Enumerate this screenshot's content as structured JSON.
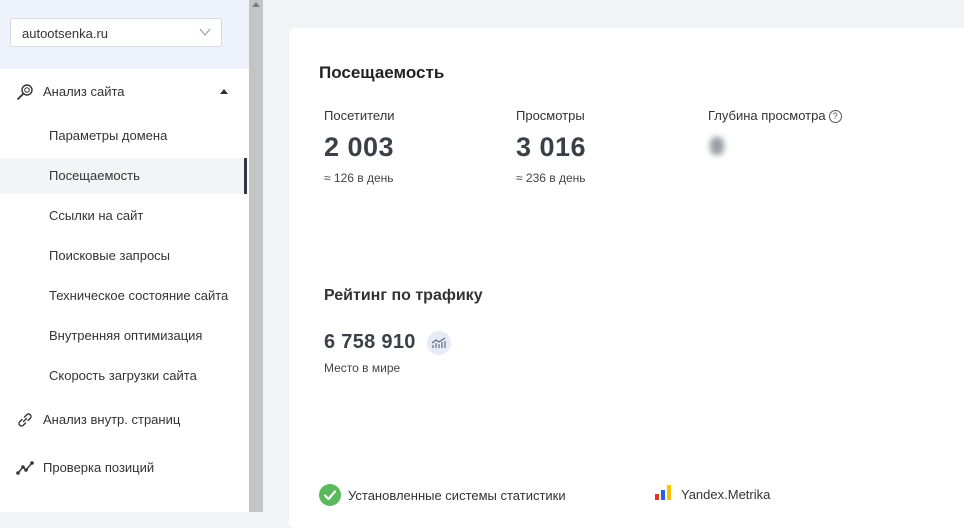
{
  "sidebar": {
    "site_select": {
      "value": "autootsenka.ru"
    },
    "groups": [
      {
        "label": "Анализ сайта",
        "icon": "magnifier-icon",
        "expanded": true
      },
      {
        "label": "Анализ внутр. страниц",
        "icon": "link-icon"
      },
      {
        "label": "Проверка позиций",
        "icon": "trend-icon"
      }
    ],
    "items": [
      {
        "label": "Параметры домена"
      },
      {
        "label": "Посещаемость",
        "active": true
      },
      {
        "label": "Ссылки на сайт"
      },
      {
        "label": "Поисковые запросы"
      },
      {
        "label": "Техническое состояние сайта"
      },
      {
        "label": "Внутренняя оптимизация"
      },
      {
        "label": "Скорость загрузки сайта"
      }
    ]
  },
  "main": {
    "title": "Посещаемость",
    "metrics": [
      {
        "label": "Посетители",
        "value": "2 003",
        "sub": "≈ 126 в день"
      },
      {
        "label": "Просмотры",
        "value": "3 016",
        "sub": "≈ 236 в день"
      },
      {
        "label": "Глубина просмотра",
        "help_icon": "question-circle-icon",
        "value_hidden": true
      }
    ],
    "rating": {
      "title": "Рейтинг по трафику",
      "value": "6 758 910",
      "caption": "Место в мире",
      "icon": "chart-icon"
    },
    "stats": {
      "label": "Установленные системы статистики",
      "system": "Yandex.Metrika",
      "status_icon": "check-circle-icon"
    }
  },
  "colors": {
    "accent_dark": "#2b3647",
    "success": "#5cb85c",
    "background": "#f2f3f5",
    "ym_red": "#e6332a",
    "ym_blue": "#2c5fd9",
    "ym_yellow": "#f7c400"
  }
}
